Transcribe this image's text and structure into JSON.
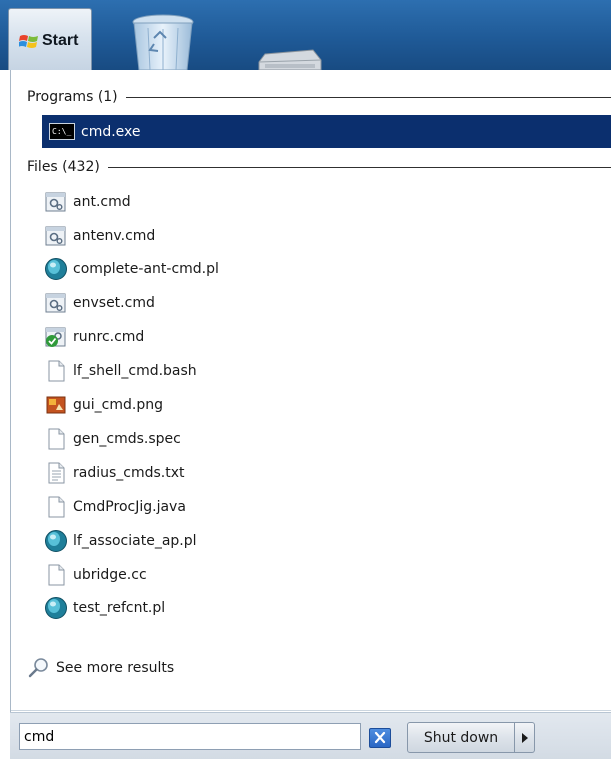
{
  "taskbar": {
    "start_label": "Start",
    "start_icon": "windows-logo-icon",
    "desktop_icons": [
      "recycle-bin-icon",
      "drive-icon"
    ]
  },
  "programs": {
    "header": "Programs (1)",
    "items": [
      {
        "label": "cmd.exe",
        "icon": "command-prompt-icon",
        "selected": true
      }
    ]
  },
  "files": {
    "header": "Files (432)",
    "items": [
      {
        "label": "ant.cmd",
        "icon": "batch-file-icon"
      },
      {
        "label": "antenv.cmd",
        "icon": "batch-file-icon"
      },
      {
        "label": "complete-ant-cmd.pl",
        "icon": "perl-script-icon"
      },
      {
        "label": "envset.cmd",
        "icon": "batch-file-icon"
      },
      {
        "label": "runrc.cmd",
        "icon": "shield-batch-file-icon"
      },
      {
        "label": "lf_shell_cmd.bash",
        "icon": "blank-file-icon"
      },
      {
        "label": "gui_cmd.png",
        "icon": "image-file-icon"
      },
      {
        "label": "gen_cmds.spec",
        "icon": "blank-file-icon"
      },
      {
        "label": "radius_cmds.txt",
        "icon": "text-file-icon"
      },
      {
        "label": "CmdProcJig.java",
        "icon": "blank-file-icon"
      },
      {
        "label": "lf_associate_ap.pl",
        "icon": "perl-script-icon"
      },
      {
        "label": "ubridge.cc",
        "icon": "blank-file-icon"
      },
      {
        "label": "test_refcnt.pl",
        "icon": "perl-script-icon"
      }
    ]
  },
  "see_more": {
    "label": "See more results",
    "icon": "search-icon"
  },
  "search": {
    "value": "cmd",
    "clear_icon": "clear-icon"
  },
  "shutdown": {
    "label": "Shut down",
    "arrow_icon": "chevron-right-icon"
  },
  "colors": {
    "selection": "#0b2f6e",
    "desktop": "#1f5a97",
    "panel_bar": "#d3dbe4"
  }
}
